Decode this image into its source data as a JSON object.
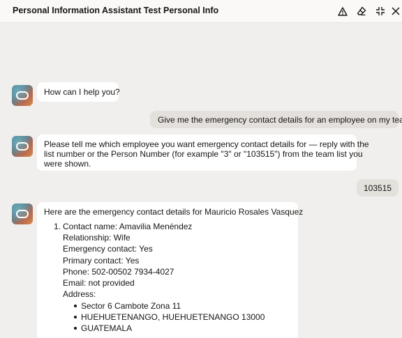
{
  "header": {
    "title": "Personal Information Assistant Test Personal Info",
    "icons": [
      "warning-icon",
      "eraser-icon",
      "collapse-icon",
      "close-icon"
    ]
  },
  "messages": {
    "m1": {
      "text": "How can I help you?"
    },
    "m2": {
      "text": "Give me the emergency contact details for an employee on my team."
    },
    "m3": {
      "line1": "Please tell me which employee you want emergency contact details for — reply with the",
      "line2": "list number or the Person Number (for example \"3\" or \"103515\") from the team list you",
      "line3": "were shown."
    },
    "m4": {
      "text": "103515"
    },
    "m5": {
      "intro": "Here are the emergency contact details for Mauricio Rosales Vasquez",
      "item_number": "1.",
      "contact_name": "Contact name: Amavilia Menéndez",
      "relationship": "Relationship: Wife",
      "emergency": "Emergency contact: Yes",
      "primary": "Primary contact: Yes",
      "phone": "Phone: 502-00502 7934-4027",
      "email": "Email: not provided",
      "address_label": "Address:",
      "address_lines": [
        "Sector 6 Cambote Zona 11",
        "HUEHUETENANGO, HUEHUETENANGO 13000",
        "GUATEMALA"
      ]
    }
  }
}
